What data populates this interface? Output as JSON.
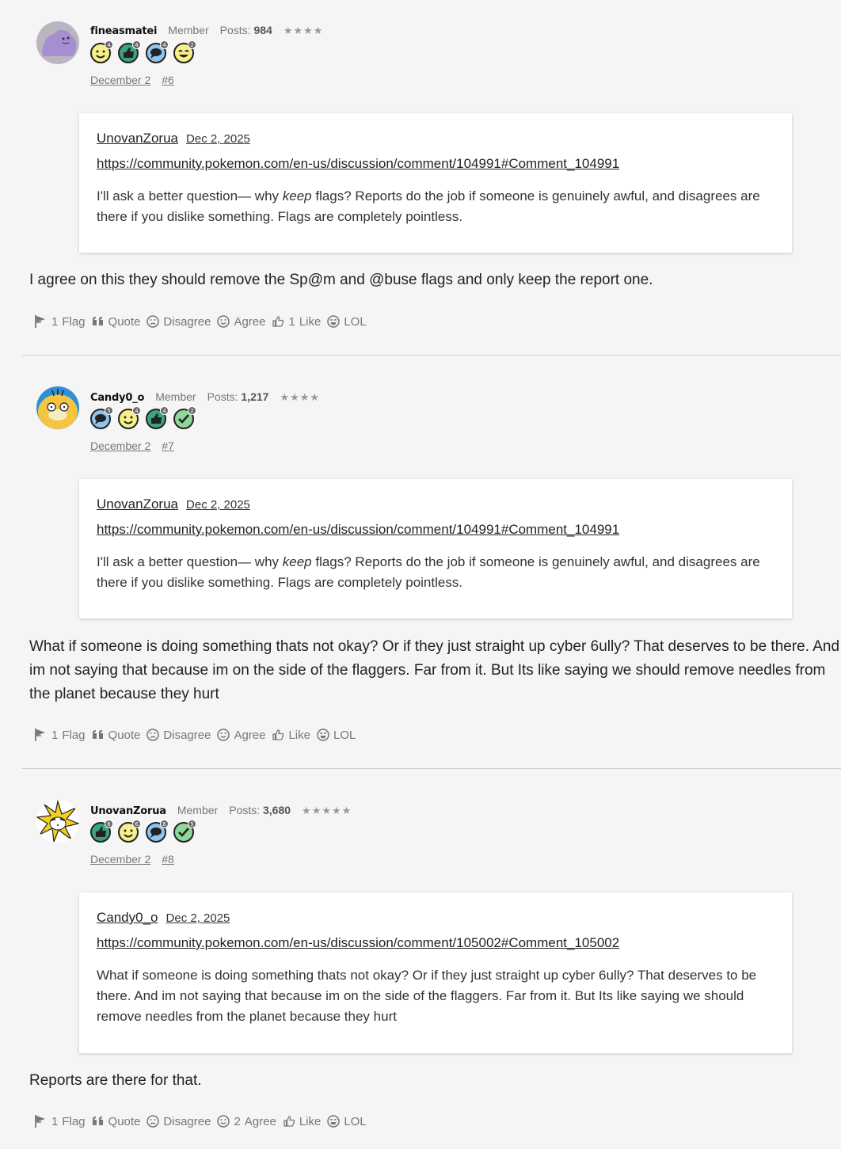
{
  "posts": [
    {
      "username": "fineasmatei",
      "role": "Member",
      "posts_label": "Posts:",
      "posts_count": "984",
      "stars": "★★★★",
      "badges": [
        {
          "icon": "smiley-badge-icon",
          "count": "4"
        },
        {
          "icon": "thumbs-up-badge-icon",
          "count": "4"
        },
        {
          "icon": "comment-badge-icon",
          "count": "4"
        },
        {
          "icon": "laugh-badge-icon",
          "count": "2"
        }
      ],
      "date": "December 2",
      "permalink": "#6",
      "quote": {
        "author": "UnovanZorua",
        "date": "Dec 2, 2025",
        "link": "https://community.pokemon.com/en-us/discussion/comment/104991#Comment_104991",
        "text_before": "I'll ask a better question— why ",
        "text_em": "keep",
        "text_after": " flags? Reports do the job if someone is genuinely awful, and disagrees are there if you dislike something. Flags are completely pointless."
      },
      "body": "I agree on this they should remove the Sp@m and @buse flags and only keep the report one.",
      "actions": {
        "flag_count": "1",
        "flag": "Flag",
        "quote": "Quote",
        "disagree_count": "",
        "disagree": "Disagree",
        "agree_count": "",
        "agree": "Agree",
        "like_count": "1",
        "like": "Like",
        "lol": "LOL"
      }
    },
    {
      "username": "Candy0_o",
      "role": "Member",
      "posts_label": "Posts:",
      "posts_count": "1,217",
      "stars": "★★★★",
      "badges": [
        {
          "icon": "comment-badge-icon",
          "count": "5"
        },
        {
          "icon": "smiley-badge-icon",
          "count": "4"
        },
        {
          "icon": "thumbs-up-badge-icon",
          "count": "4"
        },
        {
          "icon": "check-badge-icon",
          "count": "2"
        }
      ],
      "date": "December 2",
      "permalink": "#7",
      "quote": {
        "author": "UnovanZorua",
        "date": "Dec 2, 2025",
        "link": "https://community.pokemon.com/en-us/discussion/comment/104991#Comment_104991",
        "text_before": "I'll ask a better question— why ",
        "text_em": "keep",
        "text_after": " flags? Reports do the job if someone is genuinely awful, and disagrees are there if you dislike something. Flags are completely pointless."
      },
      "body": "What if someone is doing something thats not okay? Or if they just straight up cyber 6ully? That deserves to be there. And im not saying that because im on the side of the flaggers. Far from it. But Its like saying we should remove needles from the planet because they hurt",
      "actions": {
        "flag_count": "1",
        "flag": "Flag",
        "quote": "Quote",
        "disagree_count": "",
        "disagree": "Disagree",
        "agree_count": "",
        "agree": "Agree",
        "like_count": "",
        "like": "Like",
        "lol": "LOL"
      }
    },
    {
      "username": "UnovanZorua",
      "role": "Member",
      "posts_label": "Posts:",
      "posts_count": "3,680",
      "stars": "★★★★★",
      "badges": [
        {
          "icon": "thumbs-up-badge-icon",
          "count": "6"
        },
        {
          "icon": "smiley-badge-icon",
          "count": "6"
        },
        {
          "icon": "comment-badge-icon",
          "count": "6"
        },
        {
          "icon": "check-badge-icon",
          "count": "5"
        }
      ],
      "date": "December 2",
      "permalink": "#8",
      "quote": {
        "author": "Candy0_o",
        "date": "Dec 2, 2025",
        "link": "https://community.pokemon.com/en-us/discussion/comment/105002#Comment_105002",
        "text_before": "What if someone is doing something thats not okay? Or if they just straight up cyber 6ully? That deserves to be there. And im not saying that because im on the side of the flaggers. Far from it. But Its like saying we should remove needles from the planet because they hurt",
        "text_em": "",
        "text_after": ""
      },
      "body": "Reports are there for that.",
      "actions": {
        "flag_count": "1",
        "flag": "Flag",
        "quote": "Quote",
        "disagree_count": "",
        "disagree": "Disagree",
        "agree_count": "2",
        "agree": "Agree",
        "like_count": "",
        "like": "Like",
        "lol": "LOL"
      }
    }
  ]
}
